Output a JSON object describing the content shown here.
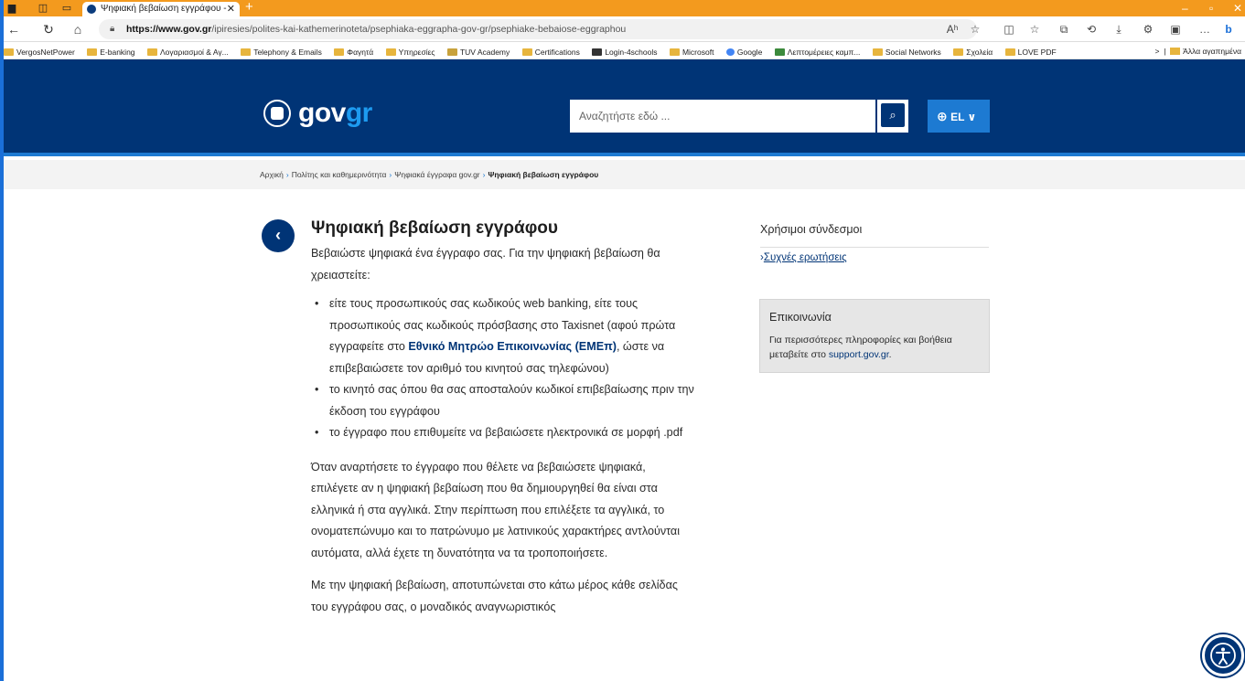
{
  "browser": {
    "tab_title": "Ψηφιακή βεβαίωση εγγράφου -",
    "url_host": "https://www.gov.gr",
    "url_path": "/ipiresies/polites-kai-kathemerinoteta/psephiaka-eggrapha-gov-gr/psephiake-bebaiose-eggraphou",
    "reader_icon": "Aʰ"
  },
  "bookmarks": [
    "VergosNetPower",
    "E-banking",
    "Λογαριασμοί & Αγ...",
    "Telephony & Emails",
    "Φαγητά",
    "Υπηρεσίες",
    "TUV Academy",
    "Certifications",
    "Login-4schools",
    "Microsoft",
    "Google",
    "Λεπτομέρειες καμπ...",
    "Social Networks",
    "Σχολεία",
    "LOVE PDF"
  ],
  "bookmarks_other": "Άλλα αγαπημένα",
  "header": {
    "logo_text": "gov",
    "logo_accent": "gr",
    "search_placeholder": "Αναζητήστε εδώ ...",
    "lang": "EL"
  },
  "breadcrumb": {
    "items": [
      "Αρχική",
      "Πολίτης και καθημερινότητα",
      "Ψηφιακά έγγραφα gov.gr"
    ],
    "current": "Ψηφιακή βεβαίωση εγγράφου"
  },
  "main": {
    "title": "Ψηφιακή βεβαίωση εγγράφου",
    "lead": "Βεβαιώστε ψηφιακά ένα έγγραφο σας. Για την ψηφιακή βεβαίωση θα χρειαστείτε:",
    "bullet1_a": "είτε τους προσωπικούς σας κωδικούς web banking, είτε τους προσωπικούς σας κωδικούς πρόσβασης στο Taxisnet (αφού πρώτα εγγραφείτε στο ",
    "bullet1_link": "Εθνικό Μητρώο Επικοινωνίας (ΕΜΕπ)",
    "bullet1_b": ", ώστε να επιβεβαιώσετε τον αριθμό του κινητού σας τηλεφώνου)",
    "bullet2": "το κινητό σας όπου θα σας αποσταλούν κωδικοί επιβεβαίωσης πριν την έκδοση του εγγράφου",
    "bullet3": "το έγγραφο που επιθυμείτε να βεβαιώσετε ηλεκτρονικά σε μορφή .pdf",
    "para2": "Όταν αναρτήσετε το έγγραφο που θέλετε να βεβαιώσετε ψηφιακά, επιλέγετε αν η ψηφιακή βεβαίωση που θα δημιουργηθεί θα είναι στα ελληνικά ή στα αγγλικά. Στην περίπτωση που επιλέξετε τα αγγλικά, το ονοματεπώνυμο και το πατρώνυμο με λατινικούς χαρακτήρες αντλούνται αυτόματα, αλλά έχετε τη δυνατότητα να τα τροποποιήσετε.",
    "para3": "Με την ψηφιακή βεβαίωση, αποτυπώνεται στο κάτω μέρος κάθε σελίδας του εγγράφου σας, ο μοναδικός αναγνωριστικός"
  },
  "sidebar": {
    "useful_links_title": "Χρήσιμοι σύνδεσμοι",
    "faq_link": "Συχνές ερωτήσεις",
    "contact_title": "Επικοινωνία",
    "contact_text": "Για περισσότερες πληροφορίες και βοήθεια μεταβείτε στο ",
    "contact_link": "support.gov.gr",
    "contact_end": "."
  },
  "colors": {
    "brand_blue": "#003476",
    "accent_blue": "#1d7ad2",
    "titlebar_orange": "#f39a1e"
  }
}
